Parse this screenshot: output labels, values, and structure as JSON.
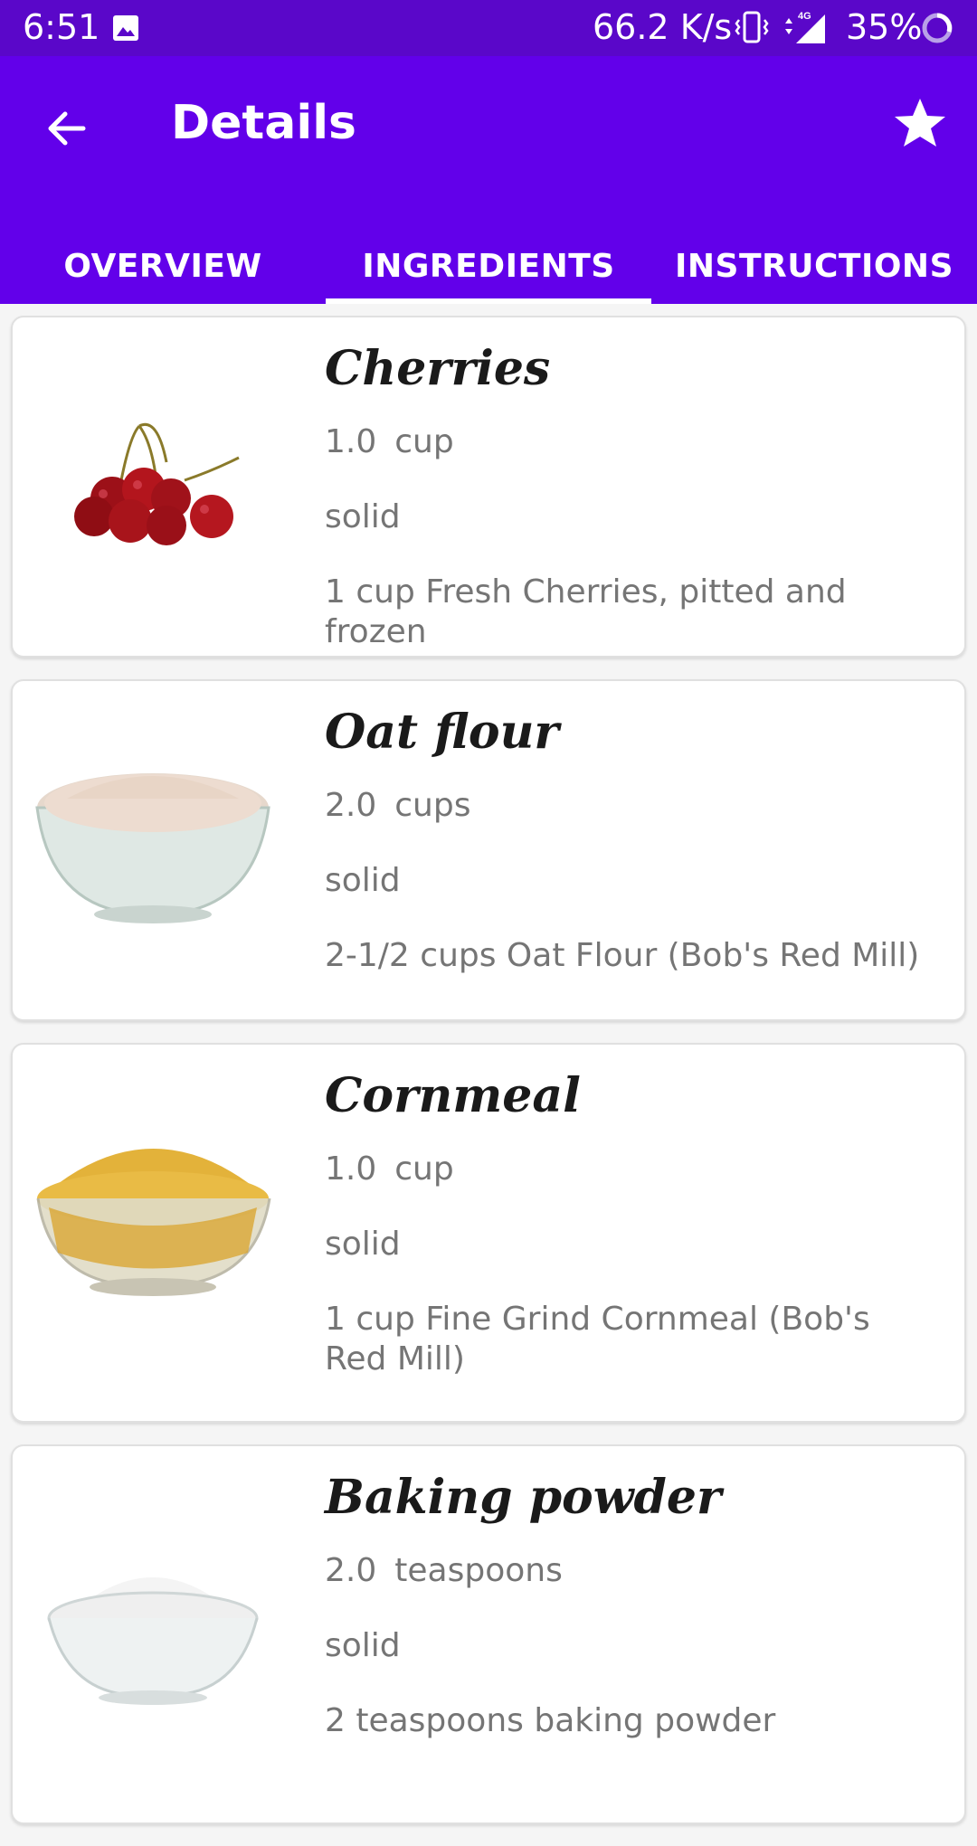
{
  "status_bar": {
    "time": "6:51",
    "network_speed": "66.2 K/s",
    "network_type": "4G",
    "battery": "35%",
    "icons": [
      "photo-icon",
      "vibrate-icon",
      "signal-icon",
      "battery-icon"
    ]
  },
  "app_bar": {
    "title": "Details",
    "back_icon": "arrow-back-icon",
    "favorite_icon": "star-icon",
    "color": "#6200ea",
    "status_color": "#5a07c9"
  },
  "tabs": [
    {
      "label": "OVERVIEW",
      "active": false
    },
    {
      "label": "INGREDIENTS",
      "active": true
    },
    {
      "label": "INSTRUCTIONS",
      "active": false
    }
  ],
  "ingredients": [
    {
      "name": "Cherries",
      "amount": "1.0",
      "unit": "cup",
      "state": "solid",
      "original": "1 cup Fresh Cherries, pitted and frozen",
      "image": "cherries-image"
    },
    {
      "name": "Oat flour",
      "amount": "2.0",
      "unit": "cups",
      "state": "solid",
      "original": "2-1/2 cups Oat Flour (Bob's Red Mill)",
      "image": "oat-flour-image"
    },
    {
      "name": "Cornmeal",
      "amount": "1.0",
      "unit": "cup",
      "state": "solid",
      "original": "1 cup Fine Grind Cornmeal (Bob's Red Mill)",
      "image": "cornmeal-image"
    },
    {
      "name": "Baking powder",
      "amount": "2.0",
      "unit": "teaspoons",
      "state": "solid",
      "original": "2 teaspoons baking powder",
      "image": "baking-powder-image"
    }
  ]
}
